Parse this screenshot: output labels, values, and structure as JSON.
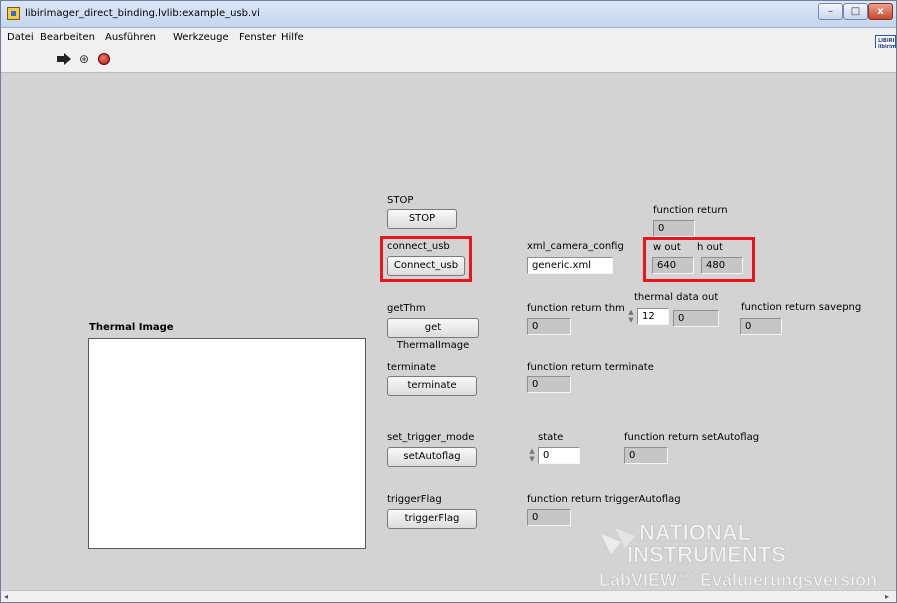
{
  "window": {
    "title": "libirimager_direct_binding.lvlib:example_usb.vi",
    "controls": {
      "minimize": "–",
      "maximize": "□",
      "close": "x"
    }
  },
  "menu": [
    "Datei",
    "Bearbeiten",
    "Ausführen",
    "Werkzeuge",
    "Fenster",
    "Hilfe"
  ],
  "vi_icon_text": "LIBIRI libirim",
  "toolbar": {
    "icons": [
      "run-arrow-icon",
      "run-continuously-icon",
      "abort-stop-icon"
    ],
    "run_continuously_glyph": "⊛"
  },
  "panel": {
    "stop": {
      "label": "STOP",
      "button": "STOP"
    },
    "connect_usb": {
      "label": "connect_usb",
      "button": "Connect_usb"
    },
    "xml_camera_config": {
      "label": "xml_camera_config",
      "value": "generic.xml"
    },
    "function_return": {
      "label": "function return",
      "value": "0"
    },
    "w_out": {
      "label": "w out",
      "value": "640"
    },
    "h_out": {
      "label": "h out",
      "value": "480"
    },
    "getThm": {
      "label": "getThm",
      "button": "get ThermalImage"
    },
    "function_return_thm": {
      "label": "function return thm",
      "value": "0"
    },
    "thermal_data_out": {
      "label": "thermal data out",
      "index": "12",
      "value": "0"
    },
    "function_return_savepng": {
      "label": "function return savepng",
      "value": "0"
    },
    "thermal_image": {
      "label": "Thermal Image"
    },
    "terminate": {
      "label": "terminate",
      "button": "terminate"
    },
    "function_return_terminate": {
      "label": "function return terminate",
      "value": "0"
    },
    "set_trigger_mode": {
      "label": "set_trigger_mode",
      "button": "setAutoflag"
    },
    "state": {
      "label": "state",
      "value": "0"
    },
    "function_return_setAutoflag": {
      "label": "function return setAutoflag",
      "value": "0"
    },
    "triggerFlag": {
      "label": "triggerFlag",
      "button": "triggerFlag"
    },
    "function_return_triggerAutoflag": {
      "label": "function return triggerAutoflag",
      "value": "0"
    }
  },
  "watermark": {
    "line1": "NATIONAL",
    "line2": "INSTRUMENTS",
    "line3": "LabVIEW™ Evaluierungsversion"
  },
  "highlight_color": "#e8151b",
  "scrollbar": {
    "left_arrow": "◂",
    "right_arrow": "▸"
  }
}
